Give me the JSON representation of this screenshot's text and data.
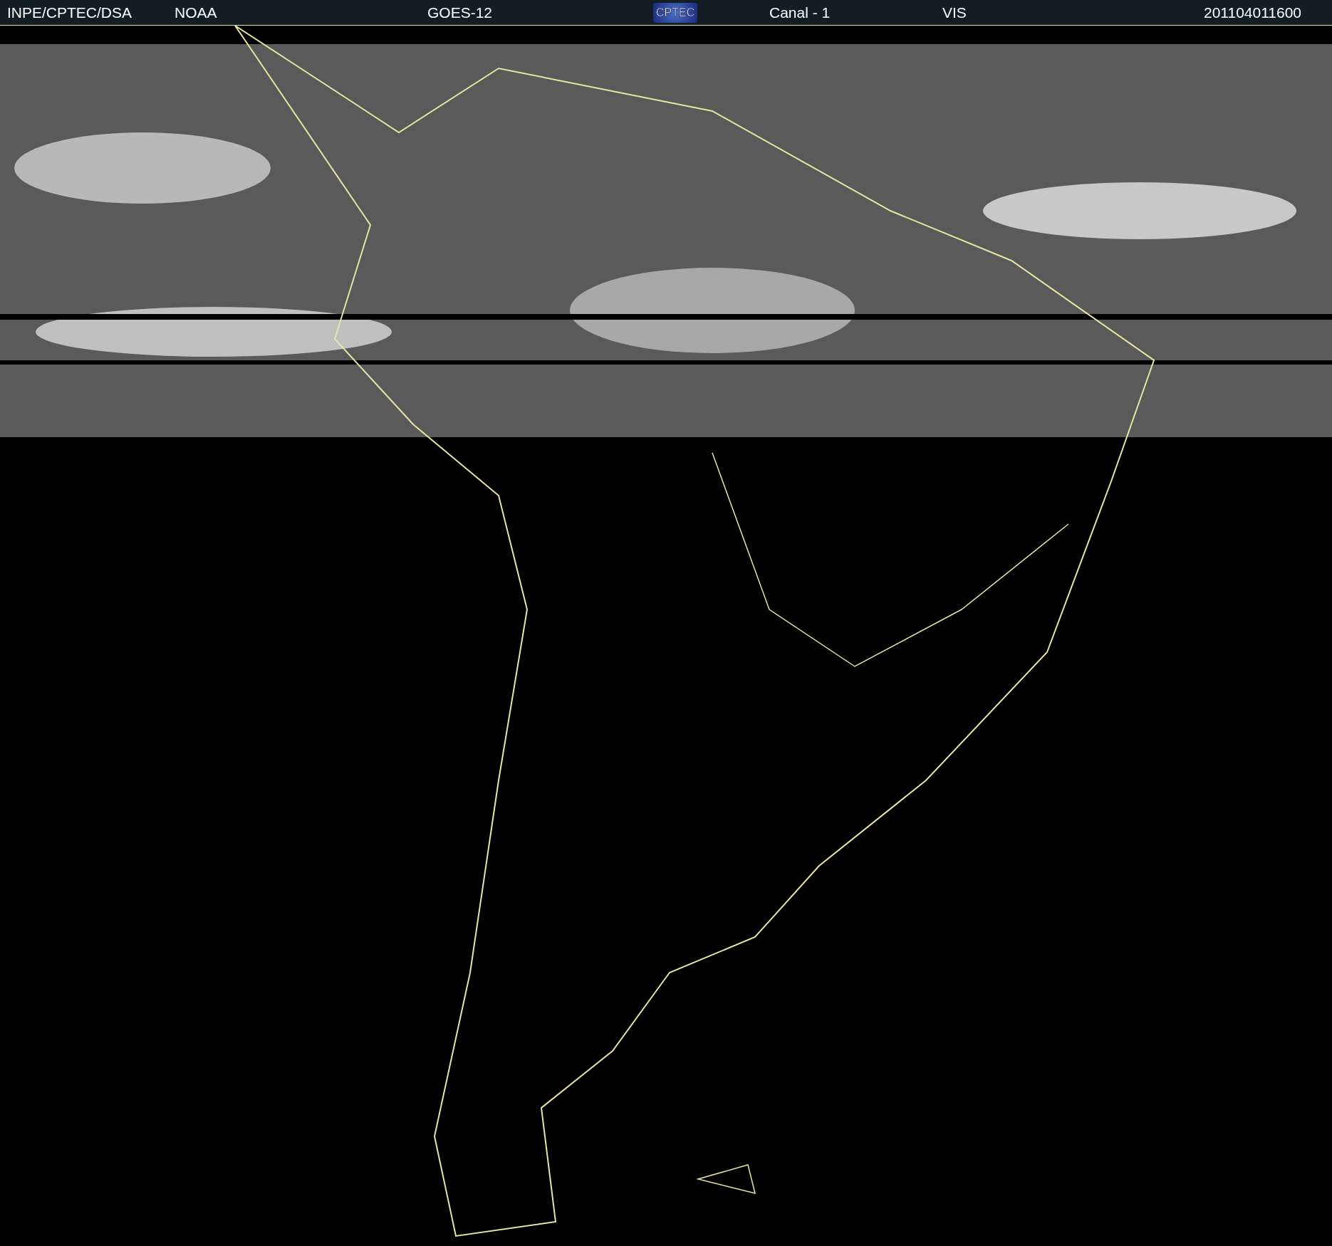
{
  "header": {
    "items": [
      {
        "kind": "text",
        "text": "INPE/CPTEC/DSA"
      },
      {
        "kind": "text",
        "text": "NOAA"
      },
      {
        "kind": "text",
        "text": "GOES-12"
      },
      {
        "kind": "logo",
        "text": "CPTEC"
      },
      {
        "kind": "text",
        "text": "Canal - 1"
      },
      {
        "kind": "text",
        "text": "VIS"
      },
      {
        "kind": "text",
        "text": "201104011600"
      }
    ]
  }
}
